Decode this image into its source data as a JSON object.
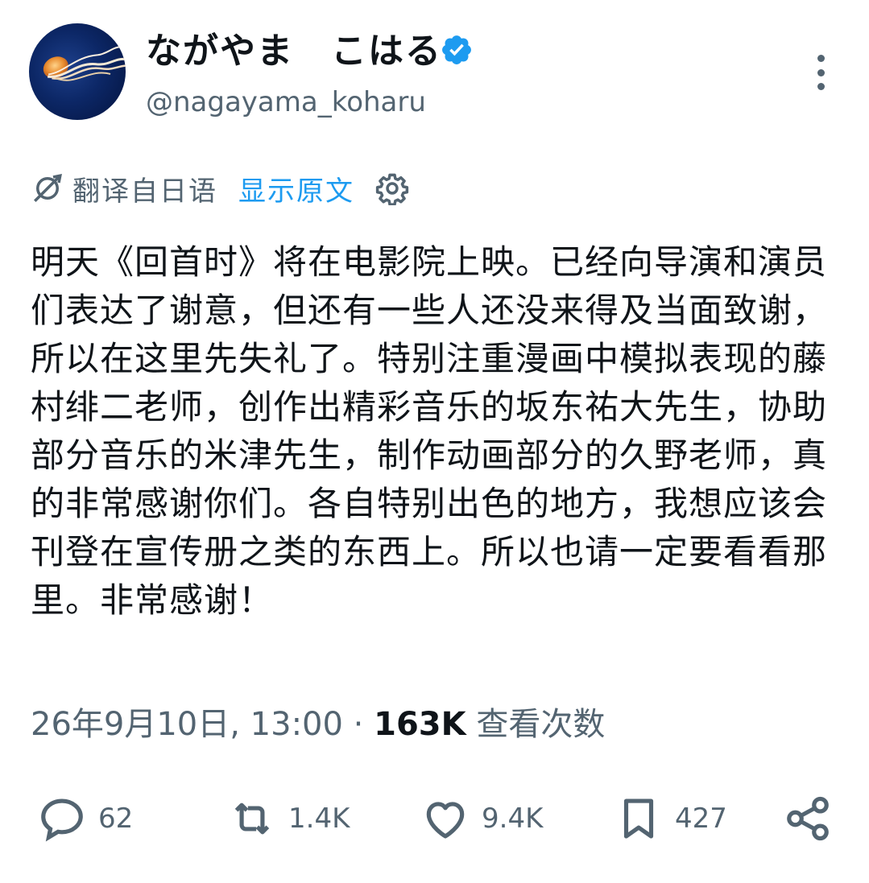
{
  "author": {
    "display_name": "ながやま　こはる",
    "handle": "@nagayama_koharu",
    "verified": true,
    "avatar_icon": "jellyfish-avatar"
  },
  "translation": {
    "label": "翻译自日语",
    "show_original": "显示原文",
    "icon": "translate-icon",
    "settings_icon": "gear-icon"
  },
  "tweet": {
    "text": "明天《回首时》将在电影院上映。已经向导演和演员们表达了谢意，但还有一些人还没来得及当面致谢，所以在这里先失礼了。特别注重漫画中模拟表现的藤村绯二老师，创作出精彩音乐的坂东祐大先生，协助部分音乐的米津先生，制作动画部分的久野老师，真的非常感谢你们。各自特别出色的地方，我想应该会刊登在宣传册之类的东西上。所以也请一定要看看那里。非常感谢！",
    "timestamp": "26年9月10日, 13:00",
    "separator": " · ",
    "views": "163K",
    "views_label": " 查看次数"
  },
  "actions": {
    "replies": "62",
    "retweets": "1.4K",
    "likes": "9.4K",
    "bookmarks": "427"
  },
  "colors": {
    "text": "#0f1419",
    "secondary": "#536471",
    "accent": "#1d9bf0"
  }
}
